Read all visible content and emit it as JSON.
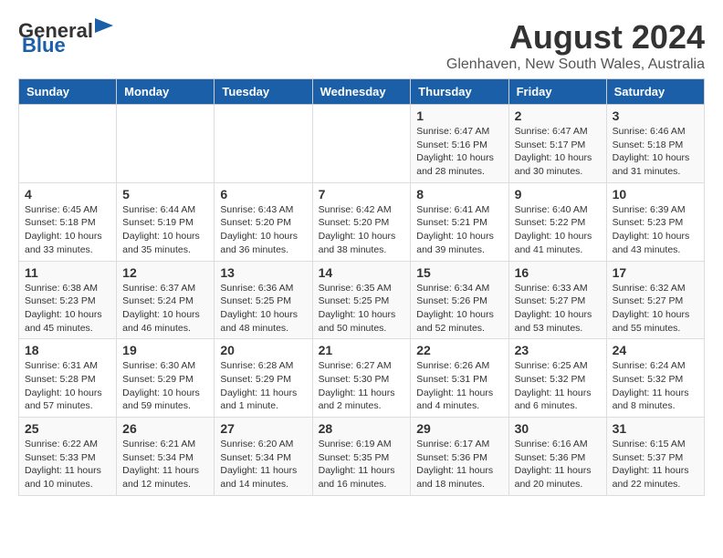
{
  "header": {
    "logo_general": "General",
    "logo_blue": "Blue",
    "title": "August 2024",
    "subtitle": "Glenhaven, New South Wales, Australia"
  },
  "weekdays": [
    "Sunday",
    "Monday",
    "Tuesday",
    "Wednesday",
    "Thursday",
    "Friday",
    "Saturday"
  ],
  "weeks": [
    [
      {
        "day": "",
        "detail": ""
      },
      {
        "day": "",
        "detail": ""
      },
      {
        "day": "",
        "detail": ""
      },
      {
        "day": "",
        "detail": ""
      },
      {
        "day": "1",
        "detail": "Sunrise: 6:47 AM\nSunset: 5:16 PM\nDaylight: 10 hours\nand 28 minutes."
      },
      {
        "day": "2",
        "detail": "Sunrise: 6:47 AM\nSunset: 5:17 PM\nDaylight: 10 hours\nand 30 minutes."
      },
      {
        "day": "3",
        "detail": "Sunrise: 6:46 AM\nSunset: 5:18 PM\nDaylight: 10 hours\nand 31 minutes."
      }
    ],
    [
      {
        "day": "4",
        "detail": "Sunrise: 6:45 AM\nSunset: 5:18 PM\nDaylight: 10 hours\nand 33 minutes."
      },
      {
        "day": "5",
        "detail": "Sunrise: 6:44 AM\nSunset: 5:19 PM\nDaylight: 10 hours\nand 35 minutes."
      },
      {
        "day": "6",
        "detail": "Sunrise: 6:43 AM\nSunset: 5:20 PM\nDaylight: 10 hours\nand 36 minutes."
      },
      {
        "day": "7",
        "detail": "Sunrise: 6:42 AM\nSunset: 5:20 PM\nDaylight: 10 hours\nand 38 minutes."
      },
      {
        "day": "8",
        "detail": "Sunrise: 6:41 AM\nSunset: 5:21 PM\nDaylight: 10 hours\nand 39 minutes."
      },
      {
        "day": "9",
        "detail": "Sunrise: 6:40 AM\nSunset: 5:22 PM\nDaylight: 10 hours\nand 41 minutes."
      },
      {
        "day": "10",
        "detail": "Sunrise: 6:39 AM\nSunset: 5:23 PM\nDaylight: 10 hours\nand 43 minutes."
      }
    ],
    [
      {
        "day": "11",
        "detail": "Sunrise: 6:38 AM\nSunset: 5:23 PM\nDaylight: 10 hours\nand 45 minutes."
      },
      {
        "day": "12",
        "detail": "Sunrise: 6:37 AM\nSunset: 5:24 PM\nDaylight: 10 hours\nand 46 minutes."
      },
      {
        "day": "13",
        "detail": "Sunrise: 6:36 AM\nSunset: 5:25 PM\nDaylight: 10 hours\nand 48 minutes."
      },
      {
        "day": "14",
        "detail": "Sunrise: 6:35 AM\nSunset: 5:25 PM\nDaylight: 10 hours\nand 50 minutes."
      },
      {
        "day": "15",
        "detail": "Sunrise: 6:34 AM\nSunset: 5:26 PM\nDaylight: 10 hours\nand 52 minutes."
      },
      {
        "day": "16",
        "detail": "Sunrise: 6:33 AM\nSunset: 5:27 PM\nDaylight: 10 hours\nand 53 minutes."
      },
      {
        "day": "17",
        "detail": "Sunrise: 6:32 AM\nSunset: 5:27 PM\nDaylight: 10 hours\nand 55 minutes."
      }
    ],
    [
      {
        "day": "18",
        "detail": "Sunrise: 6:31 AM\nSunset: 5:28 PM\nDaylight: 10 hours\nand 57 minutes."
      },
      {
        "day": "19",
        "detail": "Sunrise: 6:30 AM\nSunset: 5:29 PM\nDaylight: 10 hours\nand 59 minutes."
      },
      {
        "day": "20",
        "detail": "Sunrise: 6:28 AM\nSunset: 5:29 PM\nDaylight: 11 hours\nand 1 minute."
      },
      {
        "day": "21",
        "detail": "Sunrise: 6:27 AM\nSunset: 5:30 PM\nDaylight: 11 hours\nand 2 minutes."
      },
      {
        "day": "22",
        "detail": "Sunrise: 6:26 AM\nSunset: 5:31 PM\nDaylight: 11 hours\nand 4 minutes."
      },
      {
        "day": "23",
        "detail": "Sunrise: 6:25 AM\nSunset: 5:32 PM\nDaylight: 11 hours\nand 6 minutes."
      },
      {
        "day": "24",
        "detail": "Sunrise: 6:24 AM\nSunset: 5:32 PM\nDaylight: 11 hours\nand 8 minutes."
      }
    ],
    [
      {
        "day": "25",
        "detail": "Sunrise: 6:22 AM\nSunset: 5:33 PM\nDaylight: 11 hours\nand 10 minutes."
      },
      {
        "day": "26",
        "detail": "Sunrise: 6:21 AM\nSunset: 5:34 PM\nDaylight: 11 hours\nand 12 minutes."
      },
      {
        "day": "27",
        "detail": "Sunrise: 6:20 AM\nSunset: 5:34 PM\nDaylight: 11 hours\nand 14 minutes."
      },
      {
        "day": "28",
        "detail": "Sunrise: 6:19 AM\nSunset: 5:35 PM\nDaylight: 11 hours\nand 16 minutes."
      },
      {
        "day": "29",
        "detail": "Sunrise: 6:17 AM\nSunset: 5:36 PM\nDaylight: 11 hours\nand 18 minutes."
      },
      {
        "day": "30",
        "detail": "Sunrise: 6:16 AM\nSunset: 5:36 PM\nDaylight: 11 hours\nand 20 minutes."
      },
      {
        "day": "31",
        "detail": "Sunrise: 6:15 AM\nSunset: 5:37 PM\nDaylight: 11 hours\nand 22 minutes."
      }
    ]
  ]
}
